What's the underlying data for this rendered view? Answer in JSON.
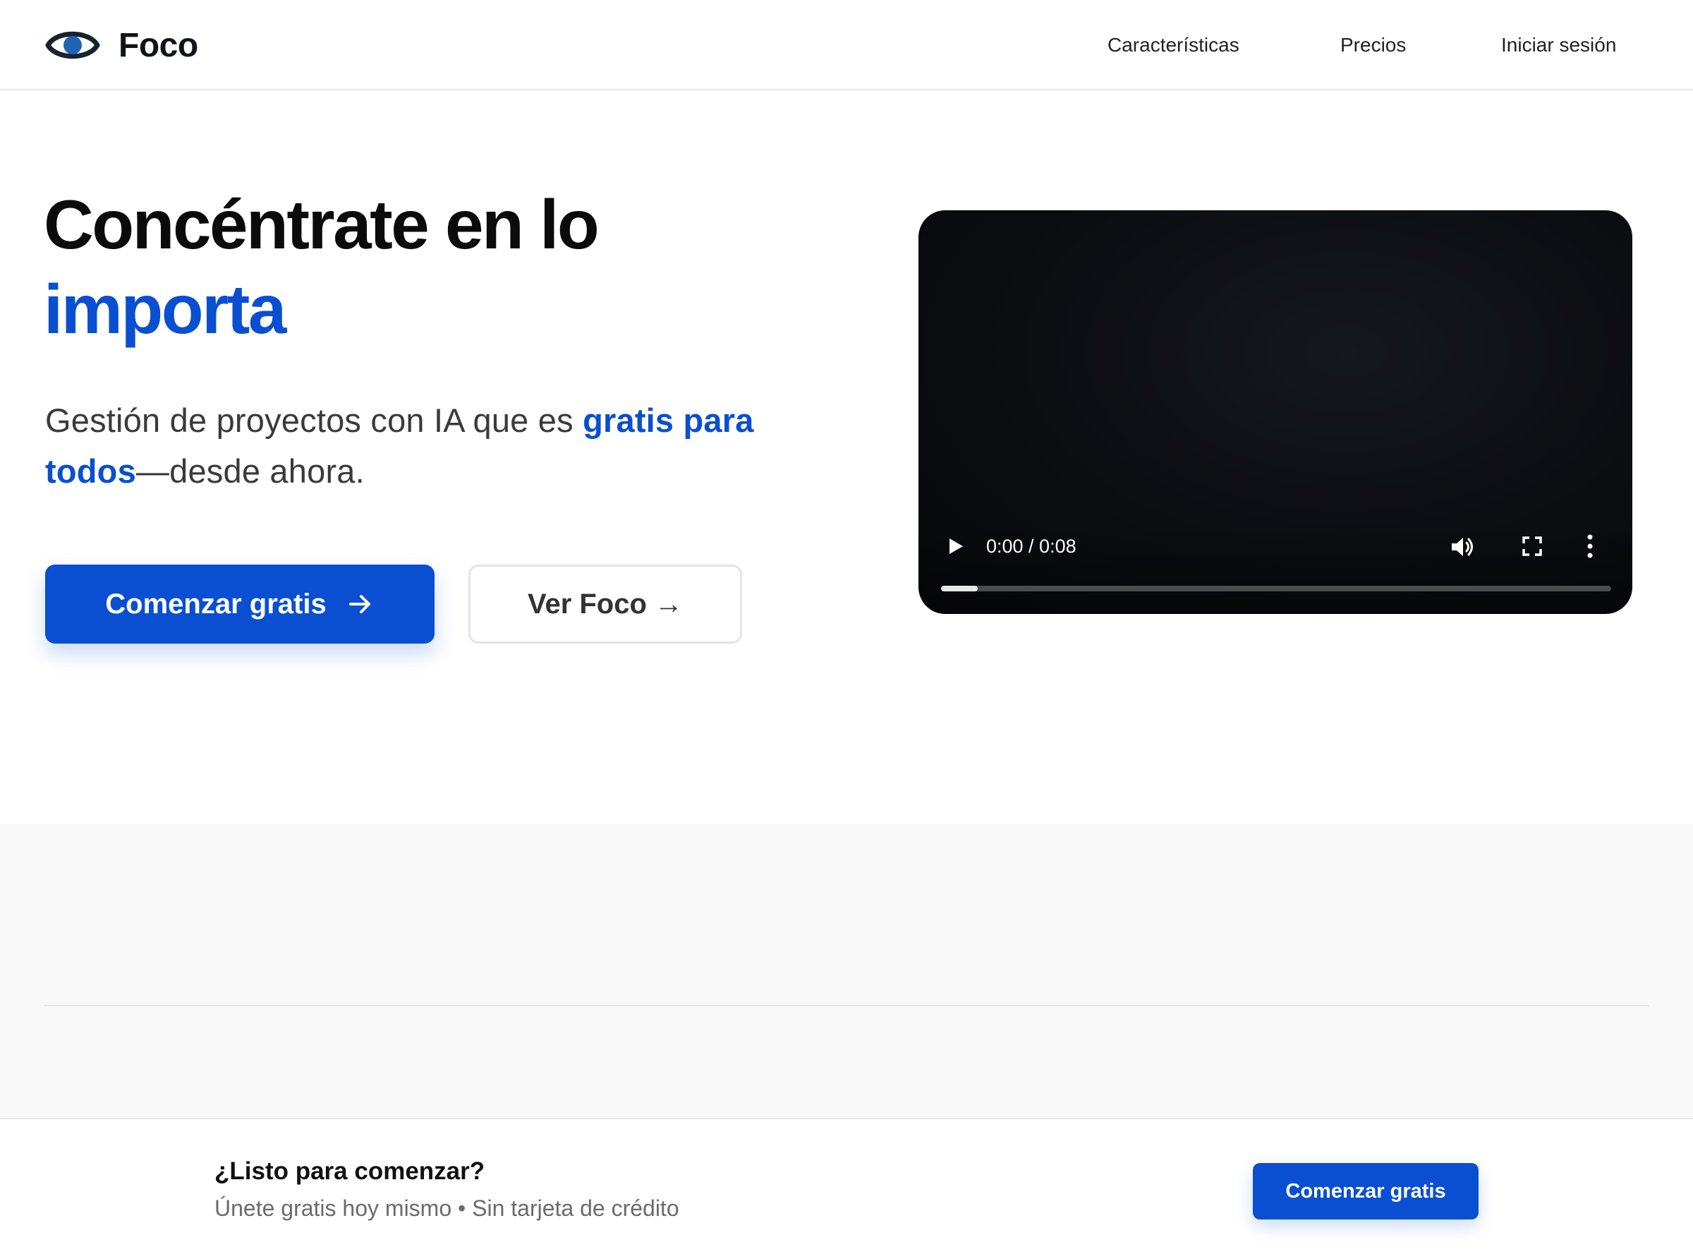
{
  "brand": {
    "name": "Foco",
    "icon": "eye-icon",
    "icon_colors": {
      "outline": "#16222e",
      "iris": "#1f63b3"
    }
  },
  "nav": {
    "items": [
      {
        "label": "Características"
      },
      {
        "label": "Precios"
      },
      {
        "label": "Iniciar sesión"
      }
    ]
  },
  "hero": {
    "title_line1": "Concéntrate en lo",
    "title_accent": "importa",
    "subtitle_before": "Gestión de proyectos con IA que es ",
    "subtitle_accent": "gratis para todos",
    "subtitle_after": "—desde ahora.",
    "primary_button": {
      "label": "Comenzar gratis",
      "icon": "arrow-right-icon"
    },
    "secondary_button": {
      "label": "Ver Foco →"
    }
  },
  "video": {
    "time": "0:00 / 0:08",
    "progress_fraction": 0.055,
    "controls": [
      "play-icon",
      "volume-icon",
      "fullscreen-icon",
      "more-vertical-icon"
    ]
  },
  "cta": {
    "title": "¿Listo para comenzar?",
    "subtitle": "Únete gratis hoy mismo • Sin tarjeta de crédito",
    "button": "Comenzar gratis"
  },
  "colors": {
    "accent": "#0a4fd1",
    "text": "#111111",
    "muted": "#6b6b6b",
    "section_bg": "#f9f9f9"
  }
}
